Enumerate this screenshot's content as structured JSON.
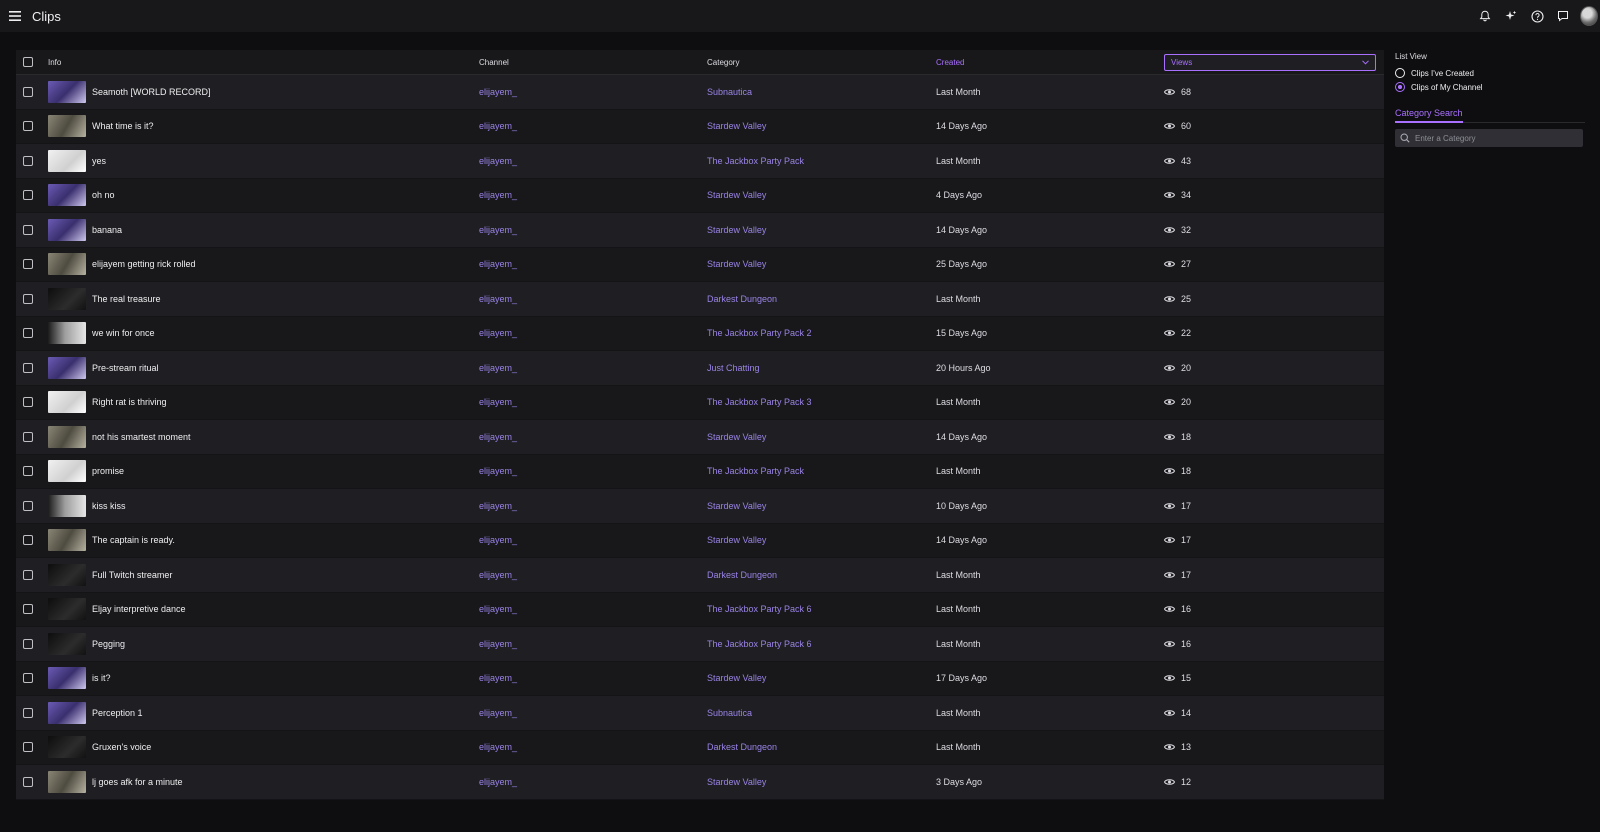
{
  "app": {
    "title": "Clips"
  },
  "colors": {
    "accent": "#a970ff",
    "link": "#9a83e6",
    "background": "#0e0e10"
  },
  "topbar_icons": [
    "bell-icon",
    "sparkle-icon",
    "help-icon",
    "chat-icon",
    "avatar"
  ],
  "table": {
    "headers": {
      "info": "Info",
      "channel": "Channel",
      "category": "Category",
      "created": "Created",
      "views": "Views"
    },
    "sort": "Views"
  },
  "rows": [
    {
      "title": "Seamoth [WORLD RECORD]",
      "channel": "elijayem_",
      "category": "Subnautica",
      "created": "Last Month",
      "views": "68",
      "thumb": "purple"
    },
    {
      "title": "What time is it?",
      "channel": "elijayem_",
      "category": "Stardew Valley",
      "created": "14 Days Ago",
      "views": "60",
      "thumb": "gray"
    },
    {
      "title": "yes",
      "channel": "elijayem_",
      "category": "The Jackbox Party Pack",
      "created": "Last Month",
      "views": "43",
      "thumb": "white"
    },
    {
      "title": "oh no",
      "channel": "elijayem_",
      "category": "Stardew Valley",
      "created": "4 Days Ago",
      "views": "34",
      "thumb": "purple"
    },
    {
      "title": "banana",
      "channel": "elijayem_",
      "category": "Stardew Valley",
      "created": "14 Days Ago",
      "views": "32",
      "thumb": "purple"
    },
    {
      "title": "elijayem getting rick rolled",
      "channel": "elijayem_",
      "category": "Stardew Valley",
      "created": "25 Days Ago",
      "views": "27",
      "thumb": "gray"
    },
    {
      "title": "The real treasure",
      "channel": "elijayem_",
      "category": "Darkest Dungeon",
      "created": "Last Month",
      "views": "25",
      "thumb": "dark"
    },
    {
      "title": "we win for once",
      "channel": "elijayem_",
      "category": "The Jackbox Party Pack 2",
      "created": "15 Days Ago",
      "views": "22",
      "thumb": "mix"
    },
    {
      "title": "Pre-stream ritual",
      "channel": "elijayem_",
      "category": "Just Chatting",
      "created": "20 Hours Ago",
      "views": "20",
      "thumb": "purple"
    },
    {
      "title": "Right rat is thriving",
      "channel": "elijayem_",
      "category": "The Jackbox Party Pack 3",
      "created": "Last Month",
      "views": "20",
      "thumb": "white"
    },
    {
      "title": "not his smartest moment",
      "channel": "elijayem_",
      "category": "Stardew Valley",
      "created": "14 Days Ago",
      "views": "18",
      "thumb": "gray"
    },
    {
      "title": "promise",
      "channel": "elijayem_",
      "category": "The Jackbox Party Pack",
      "created": "Last Month",
      "views": "18",
      "thumb": "white"
    },
    {
      "title": "kiss kiss",
      "channel": "elijayem_",
      "category": "Stardew Valley",
      "created": "10 Days Ago",
      "views": "17",
      "thumb": "mix"
    },
    {
      "title": "The captain is ready.",
      "channel": "elijayem_",
      "category": "Stardew Valley",
      "created": "14 Days Ago",
      "views": "17",
      "thumb": "gray"
    },
    {
      "title": "Full Twitch streamer",
      "channel": "elijayem_",
      "category": "Darkest Dungeon",
      "created": "Last Month",
      "views": "17",
      "thumb": "dark"
    },
    {
      "title": "Eljay interpretive dance",
      "channel": "elijayem_",
      "category": "The Jackbox Party Pack 6",
      "created": "Last Month",
      "views": "16",
      "thumb": "dark"
    },
    {
      "title": "Pegging",
      "channel": "elijayem_",
      "category": "The Jackbox Party Pack 6",
      "created": "Last Month",
      "views": "16",
      "thumb": "dark"
    },
    {
      "title": "is it?",
      "channel": "elijayem_",
      "category": "Stardew Valley",
      "created": "17 Days Ago",
      "views": "15",
      "thumb": "purple"
    },
    {
      "title": "Perception 1",
      "channel": "elijayem_",
      "category": "Subnautica",
      "created": "Last Month",
      "views": "14",
      "thumb": "purple"
    },
    {
      "title": "Gruxen's voice",
      "channel": "elijayem_",
      "category": "Darkest Dungeon",
      "created": "Last Month",
      "views": "13",
      "thumb": "dark"
    },
    {
      "title": "lj goes afk for a minute",
      "channel": "elijayem_",
      "category": "Stardew Valley",
      "created": "3 Days Ago",
      "views": "12",
      "thumb": "gray"
    }
  ],
  "sidebar": {
    "list_view_label": "List View",
    "options": [
      {
        "label": "Clips I've Created",
        "selected": false
      },
      {
        "label": "Clips of My Channel",
        "selected": true
      }
    ],
    "category_search_label": "Category Search",
    "category_placeholder": "Enter a Category"
  }
}
